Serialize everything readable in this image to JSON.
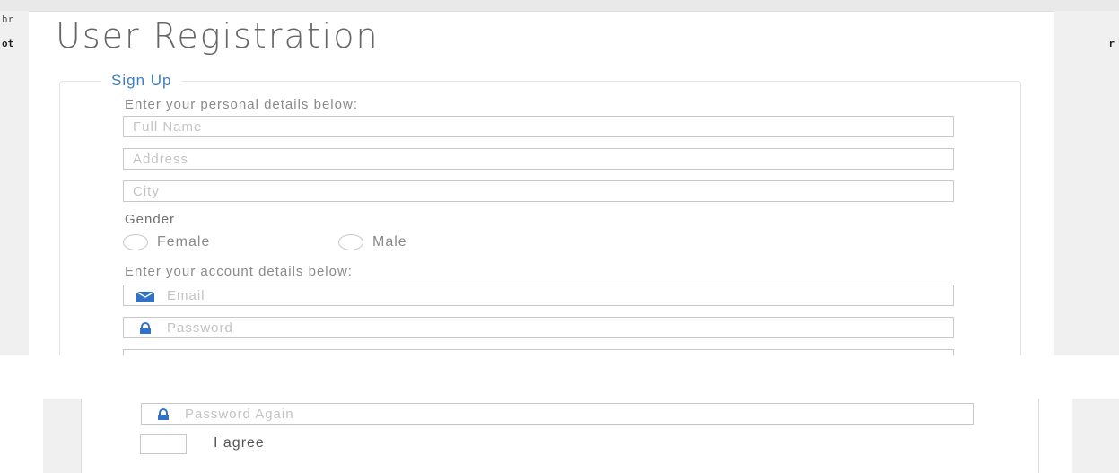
{
  "side": {
    "left_top": "hr",
    "left_mid": "ot",
    "right_mid": "r"
  },
  "page": {
    "title": "User Registration"
  },
  "form": {
    "legend": "Sign Up",
    "personal_label": "Enter your personal details below:",
    "full_name_placeholder": "Full Name",
    "address_placeholder": "Address",
    "city_placeholder": "City",
    "gender_label": "Gender",
    "gender_options": [
      "Female",
      "Male"
    ],
    "account_label": "Enter your account details below:",
    "email_placeholder": "Email",
    "password_placeholder": "Password",
    "password_again_placeholder": "Password Again",
    "agree_label": "I agree"
  },
  "icons": {
    "email": "envelope-icon",
    "password": "lock-icon",
    "password_again": "lock-icon"
  },
  "colors": {
    "accent": "#3a7fc1",
    "icon": "#2f73c8"
  }
}
